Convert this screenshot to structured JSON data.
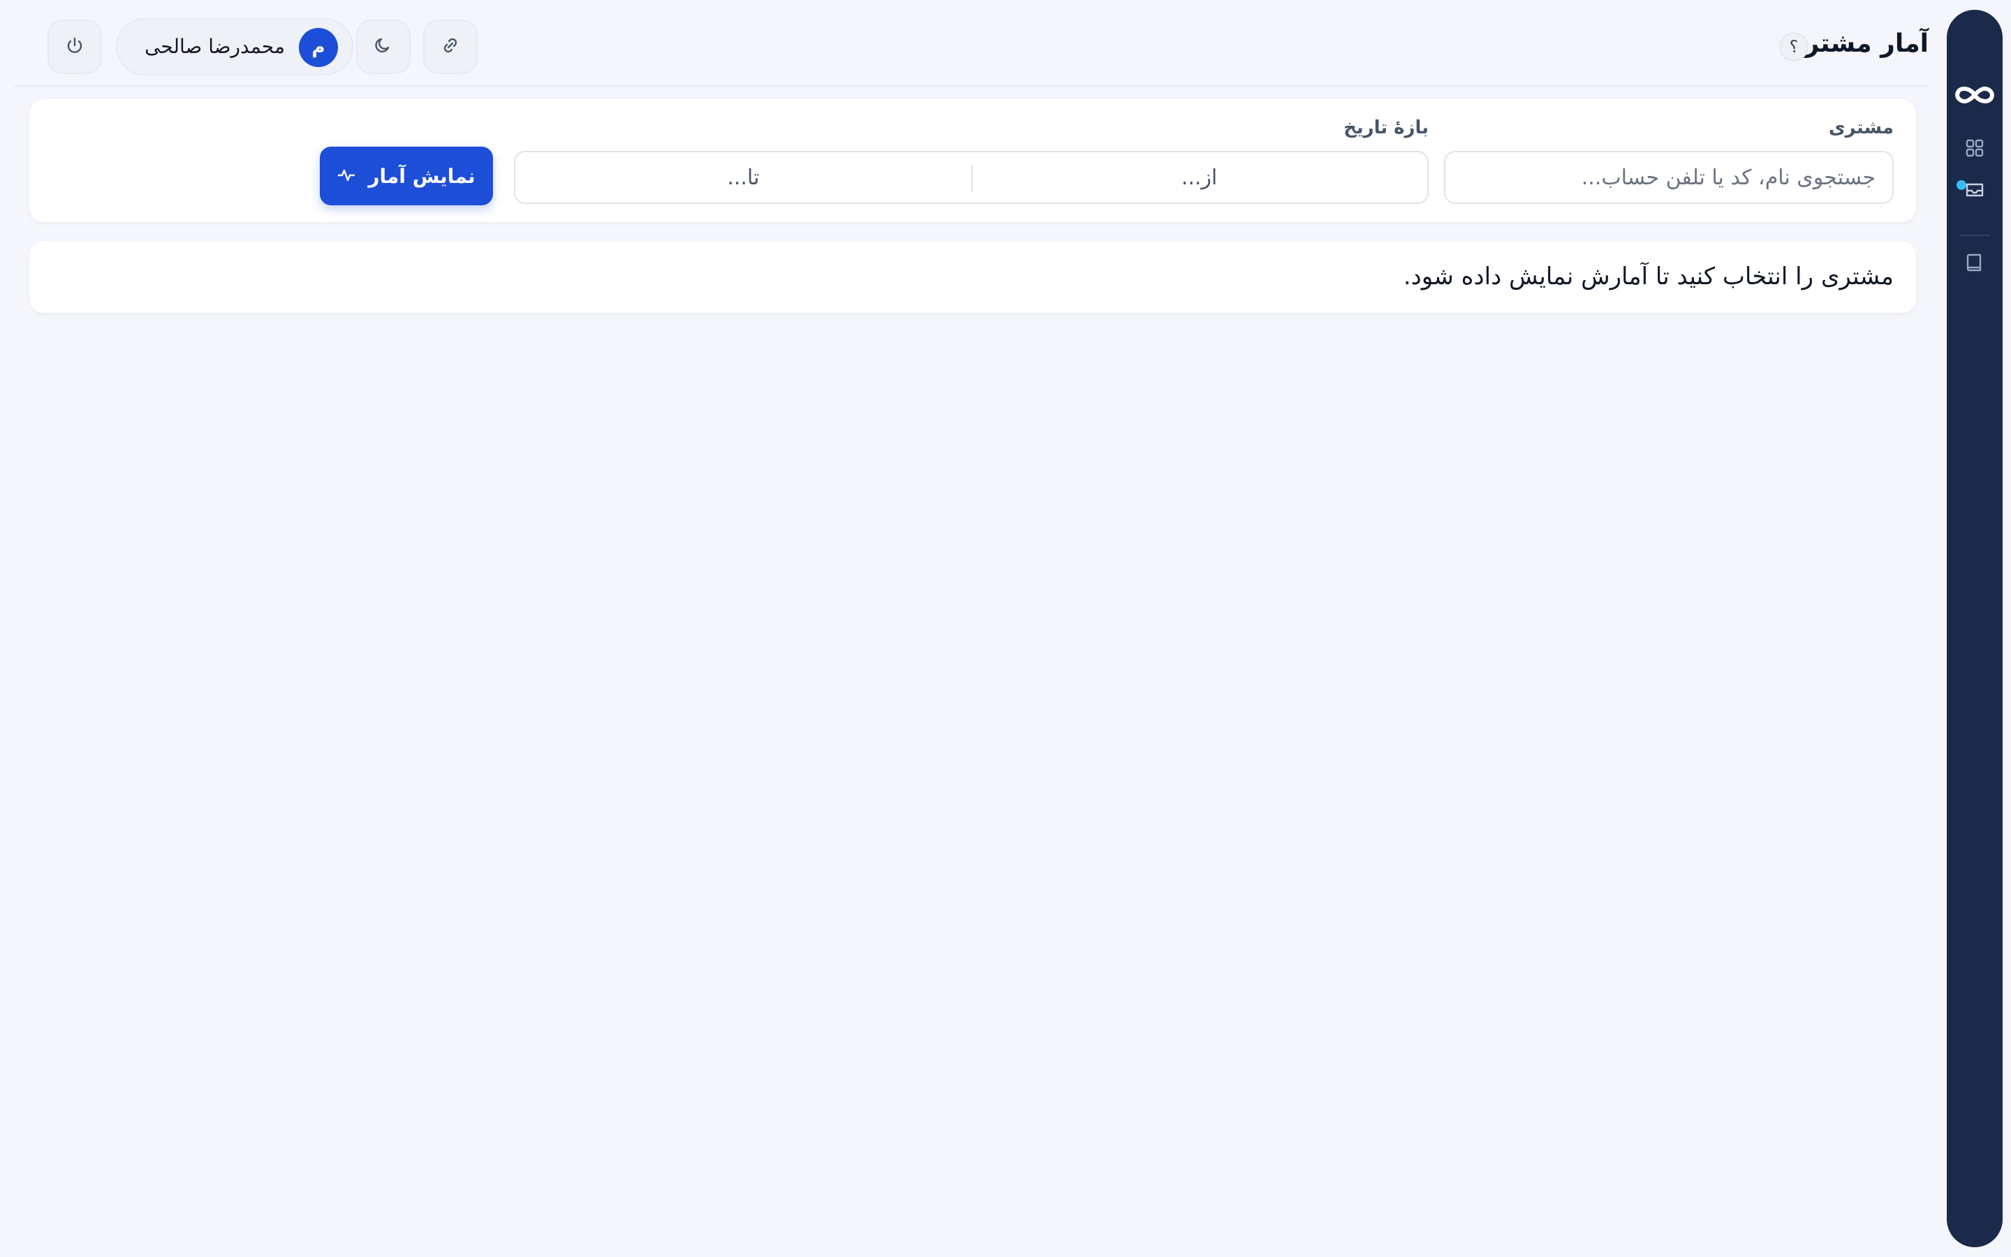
{
  "header": {
    "title": "آمار مشتری",
    "help_label": "؟",
    "user": {
      "avatar_initial": "م",
      "name": "محمدرضا صالحی"
    },
    "icons": {
      "theme": "moon-icon",
      "link": "link-icon",
      "logout": "power-icon"
    }
  },
  "rail": {
    "logo": "infinity-logo",
    "items": [
      {
        "icon": "dashboard-grid-icon"
      },
      {
        "icon": "inbox-icon",
        "has_badge": true
      },
      {
        "icon": "book-icon"
      }
    ]
  },
  "filters": {
    "customer_label": "مشتری",
    "customer_placeholder": "جستجوی نام، کد یا تلفن حساب...",
    "date_label": "بازهٔ تاریخ",
    "date_from_placeholder": "از...",
    "date_to_placeholder": "تا...",
    "submit_label": "نمایش آمار"
  },
  "empty_state": {
    "message": "مشتری را انتخاب کنید تا آمارش نمایش داده شود."
  },
  "colors": {
    "rail_bg": "#1b2a4a",
    "primary": "#1d4ed8",
    "page_bg": "#f4f6fb",
    "badge_dot": "#38bdf8"
  }
}
